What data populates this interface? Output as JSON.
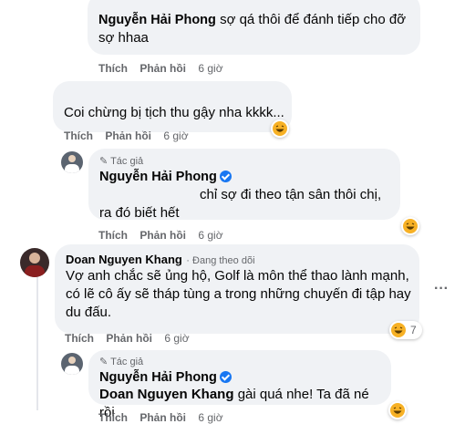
{
  "comments": [
    {
      "name": "Nguyễn Hải Phong",
      "text": "sợ qá thôi để đánh tiếp cho đỡ sợ hhaa",
      "actions": {
        "like": "Thích",
        "reply": "Phản hồi",
        "time": "6 giờ"
      }
    },
    {
      "text": "Coi chừng bị tịch thu gậy nha kkkk...",
      "actions": {
        "like": "Thích",
        "reply": "Phản hồi",
        "time": "6 giờ"
      },
      "reaction": "haha"
    },
    {
      "tag": "Tác giả",
      "name": "Nguyễn Hải Phong",
      "text": "chỉ sợ đi theo tận sân thôi chị, ra đó biết hết",
      "actions": {
        "like": "Thích",
        "reply": "Phản hồi",
        "time": "6 giờ"
      },
      "reaction": "haha"
    },
    {
      "name": "Doan Nguyen Khang",
      "meta": "· Đang theo dõi",
      "text": "Vợ anh chắc sẽ ủng hộ, Golf là môn thể thao lành mạnh, có lẽ cô ấy sẽ tháp tùng a trong những chuyến đi tập hay du đấu.",
      "actions": {
        "like": "Thích",
        "reply": "Phản hồi",
        "time": "6 giờ"
      },
      "reaction": "haha",
      "reaction_count": "7",
      "more": "···"
    },
    {
      "tag": "Tác giả",
      "name": "Nguyễn Hải Phong",
      "mention": "Doan Nguyen Khang",
      "text": "gài quá nhe! Ta đã né rồi",
      "actions": {
        "like": "Thích",
        "reply": "Phản hồi",
        "time": "6 giờ"
      },
      "reaction": "haha"
    }
  ],
  "colors": {
    "bubble": "#f0f2f5",
    "secondary_text": "#65676b",
    "verified": "#1877f2"
  }
}
